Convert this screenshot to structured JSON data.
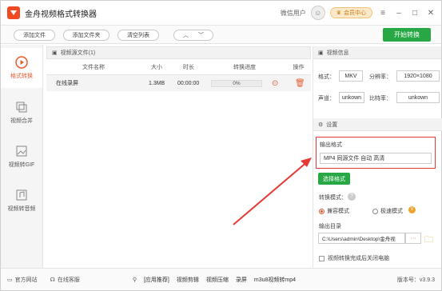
{
  "app": {
    "title": "金舟视频格式转换器",
    "user": "微信用户",
    "vip": "会员中心"
  },
  "toolbar": {
    "add_file": "添加文件",
    "add_folder": "添加文件夹",
    "clear": "清空列表",
    "start": "开始转换"
  },
  "sidebar": {
    "items": [
      {
        "label": "格式转换",
        "icon": "convert-icon"
      },
      {
        "label": "视频合并",
        "icon": "merge-icon"
      },
      {
        "label": "视频转GIF",
        "icon": "gif-icon"
      },
      {
        "label": "视频转音频",
        "icon": "audio-icon"
      }
    ]
  },
  "filelist": {
    "header": "视频源文件(1)",
    "columns": [
      "文件名称",
      "大小",
      "时长",
      "转换进度",
      "操作"
    ],
    "rows": [
      {
        "name": "在线录屏",
        "size": "1.3MB",
        "duration": "00:00:00",
        "progress": "0%"
      }
    ]
  },
  "video_info": {
    "title": "视频信息",
    "format_label": "格式：",
    "format": "MKV",
    "resolution_label": "分辨率：",
    "resolution": "1920×1080",
    "channel_label": "声道：",
    "channel": "unkown",
    "bitrate_label": "比特率：",
    "bitrate": "unkown"
  },
  "settings": {
    "title": "设置",
    "output_format_label": "输出格式",
    "output_format": "MP4 同源文件 自动 高清",
    "select_format": "选择格式",
    "mode_label": "转换模式：",
    "mode_compat": "兼容模式",
    "mode_fast": "极速模式",
    "output_dir_label": "输出目录",
    "output_dir": "C:\\Users\\admin\\Desktop\\金舟视",
    "dir_more": "···",
    "close_after": "视频转换完成后关闭电脑"
  },
  "statusbar": {
    "website": "官方网站",
    "support": "在线客服",
    "links": [
      "[应用推荐]",
      "视频剪辑",
      "视频压缩",
      "录屏",
      "m3u8视频转mp4"
    ],
    "version": "版本号：v3.9.3"
  },
  "colors": {
    "accent_green": "#27a845",
    "accent_orange": "#e85b2e",
    "annotation_red": "#e53935"
  }
}
